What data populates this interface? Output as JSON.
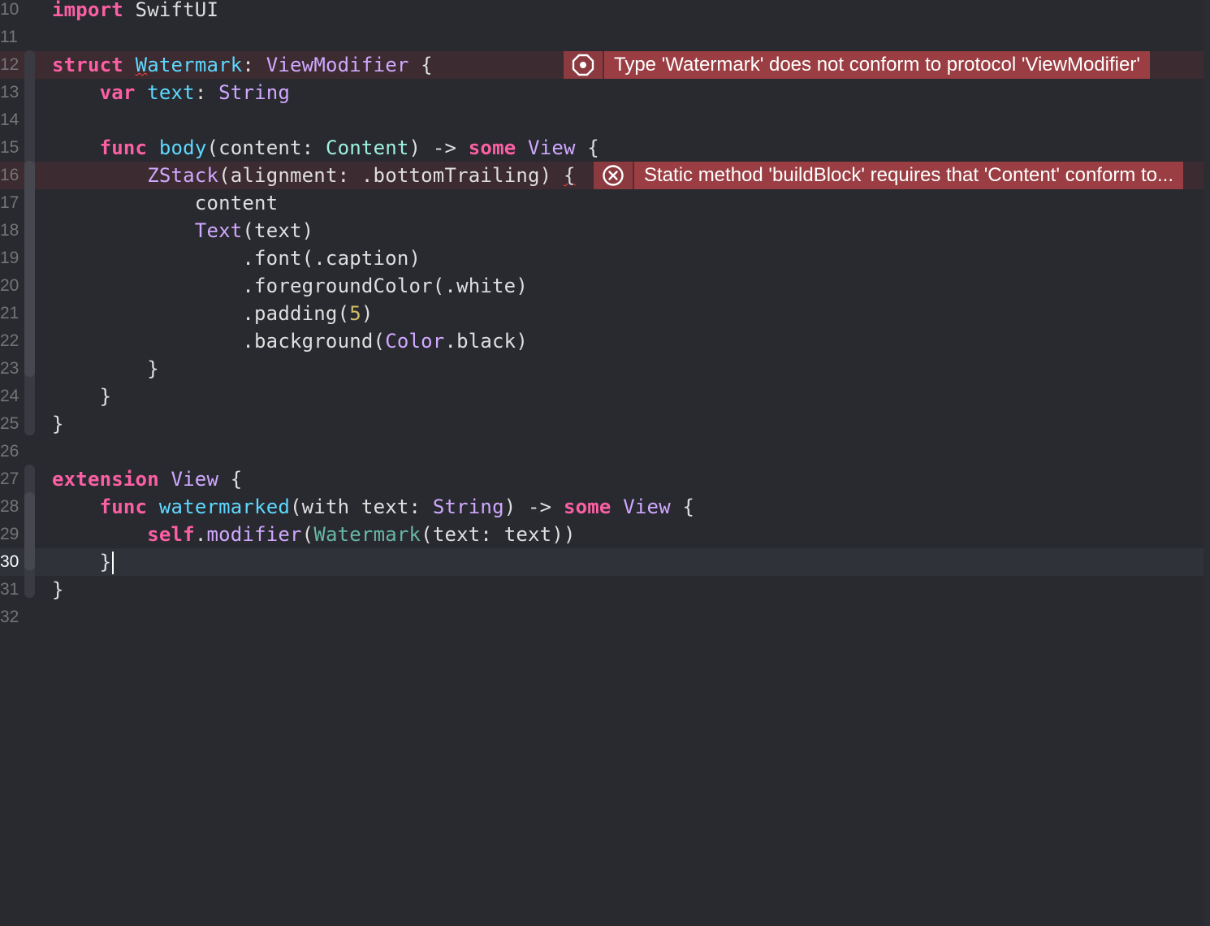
{
  "editor": {
    "current_line": "30",
    "lines": [
      {
        "num": "10",
        "tokens": [
          {
            "t": "import",
            "c": "kw"
          },
          {
            "t": " SwiftUI",
            "c": ""
          }
        ]
      },
      {
        "num": "11",
        "tokens": []
      },
      {
        "num": "12",
        "tokens": [
          {
            "t": "struct",
            "c": "kw"
          },
          {
            "t": " ",
            "c": ""
          },
          {
            "t": "W",
            "c": "decl sq"
          },
          {
            "t": "atermark",
            "c": "decl"
          },
          {
            "t": ": ",
            "c": ""
          },
          {
            "t": "ViewModifier",
            "c": "typ"
          },
          {
            "t": " {",
            "c": ""
          }
        ]
      },
      {
        "num": "13",
        "tokens": [
          {
            "t": "    ",
            "c": ""
          },
          {
            "t": "var",
            "c": "kw"
          },
          {
            "t": " ",
            "c": ""
          },
          {
            "t": "text",
            "c": "decl"
          },
          {
            "t": ": ",
            "c": ""
          },
          {
            "t": "String",
            "c": "typ"
          }
        ]
      },
      {
        "num": "14",
        "tokens": []
      },
      {
        "num": "15",
        "tokens": [
          {
            "t": "    ",
            "c": ""
          },
          {
            "t": "func",
            "c": "kw"
          },
          {
            "t": " ",
            "c": ""
          },
          {
            "t": "body",
            "c": "decl"
          },
          {
            "t": "(content: ",
            "c": ""
          },
          {
            "t": "Content",
            "c": "proj"
          },
          {
            "t": ") -> ",
            "c": ""
          },
          {
            "t": "some",
            "c": "kw"
          },
          {
            "t": " ",
            "c": ""
          },
          {
            "t": "View",
            "c": "typ"
          },
          {
            "t": " {",
            "c": ""
          }
        ]
      },
      {
        "num": "16",
        "tokens": [
          {
            "t": "        ",
            "c": ""
          },
          {
            "t": "ZStack",
            "c": "typ"
          },
          {
            "t": "(alignment: .bottomTrailing) ",
            "c": ""
          },
          {
            "t": "{",
            "c": "sq"
          }
        ]
      },
      {
        "num": "17",
        "tokens": [
          {
            "t": "            content",
            "c": ""
          }
        ]
      },
      {
        "num": "18",
        "tokens": [
          {
            "t": "            ",
            "c": ""
          },
          {
            "t": "Text",
            "c": "typ"
          },
          {
            "t": "(text)",
            "c": ""
          }
        ]
      },
      {
        "num": "19",
        "tokens": [
          {
            "t": "                .font(.caption)",
            "c": ""
          }
        ]
      },
      {
        "num": "20",
        "tokens": [
          {
            "t": "                .foregroundColor(.white)",
            "c": ""
          }
        ]
      },
      {
        "num": "21",
        "tokens": [
          {
            "t": "                .padding(",
            "c": ""
          },
          {
            "t": "5",
            "c": "num"
          },
          {
            "t": ")",
            "c": ""
          }
        ]
      },
      {
        "num": "22",
        "tokens": [
          {
            "t": "                .background(",
            "c": ""
          },
          {
            "t": "Color",
            "c": "typ"
          },
          {
            "t": ".black)",
            "c": ""
          }
        ]
      },
      {
        "num": "23",
        "tokens": [
          {
            "t": "        }",
            "c": ""
          }
        ]
      },
      {
        "num": "24",
        "tokens": [
          {
            "t": "    }",
            "c": ""
          }
        ]
      },
      {
        "num": "25",
        "tokens": [
          {
            "t": "}",
            "c": ""
          }
        ]
      },
      {
        "num": "26",
        "tokens": []
      },
      {
        "num": "27",
        "tokens": [
          {
            "t": "extension",
            "c": "kw"
          },
          {
            "t": " ",
            "c": ""
          },
          {
            "t": "View",
            "c": "typ"
          },
          {
            "t": " {",
            "c": ""
          }
        ]
      },
      {
        "num": "28",
        "tokens": [
          {
            "t": "    ",
            "c": ""
          },
          {
            "t": "func",
            "c": "kw"
          },
          {
            "t": " ",
            "c": ""
          },
          {
            "t": "watermarked",
            "c": "decl"
          },
          {
            "t": "(with text: ",
            "c": ""
          },
          {
            "t": "String",
            "c": "typ"
          },
          {
            "t": ") -> ",
            "c": ""
          },
          {
            "t": "some",
            "c": "kw"
          },
          {
            "t": " ",
            "c": ""
          },
          {
            "t": "View",
            "c": "typ"
          },
          {
            "t": " {",
            "c": ""
          }
        ]
      },
      {
        "num": "29",
        "tokens": [
          {
            "t": "        ",
            "c": ""
          },
          {
            "t": "self",
            "c": "kw"
          },
          {
            "t": ".",
            "c": ""
          },
          {
            "t": "modifier",
            "c": "typ"
          },
          {
            "t": "(",
            "c": ""
          },
          {
            "t": "Watermark",
            "c": "fn"
          },
          {
            "t": "(text: text))",
            "c": ""
          }
        ]
      },
      {
        "num": "30",
        "tokens": [
          {
            "t": "    }",
            "c": ""
          }
        ]
      },
      {
        "num": "31",
        "tokens": [
          {
            "t": "}",
            "c": ""
          }
        ]
      },
      {
        "num": "32",
        "tokens": []
      }
    ]
  },
  "errors": [
    {
      "line": "12",
      "icon": "error-octagon-icon",
      "message": "Type 'Watermark' does not conform to protocol 'ViewModifier'"
    },
    {
      "line": "16",
      "icon": "error-circle-x-icon",
      "message": "Static method 'buildBlock' requires that 'Content' conform to..."
    }
  ],
  "colors": {
    "background": "#292a30",
    "keyword": "#fc5fa3",
    "type": "#d0a8ff",
    "declaration": "#5dd8ff",
    "project_type": "#9ef1dd",
    "number": "#d0bf69",
    "error": "#9a3e43"
  }
}
